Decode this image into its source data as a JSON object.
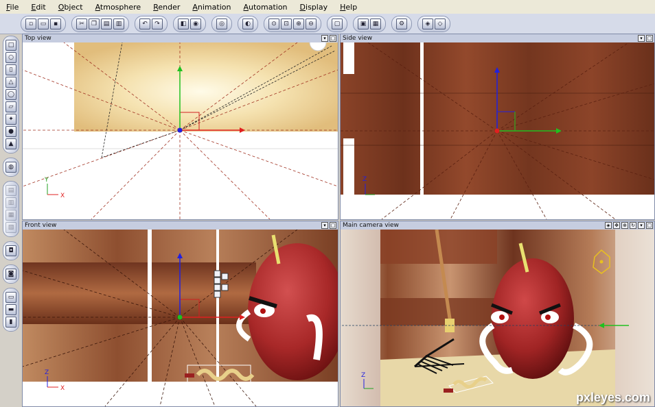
{
  "menu": [
    "File",
    "Edit",
    "Object",
    "Atmosphere",
    "Render",
    "Animation",
    "Automation",
    "Display",
    "Help"
  ],
  "viewports": {
    "top": {
      "title": "Top view"
    },
    "side": {
      "title": "Side view"
    },
    "front": {
      "title": "Front view"
    },
    "camera": {
      "title": "Main camera view"
    }
  },
  "axis_labels": {
    "x": "X",
    "y": "Y",
    "z": "Z"
  },
  "watermark": "pxleyes.com",
  "colors": {
    "wood": "#7a3a22",
    "apple": "#b02a2a",
    "axis_x": "#e02020",
    "axis_y": "#20c020",
    "axis_z": "#2020e0"
  }
}
